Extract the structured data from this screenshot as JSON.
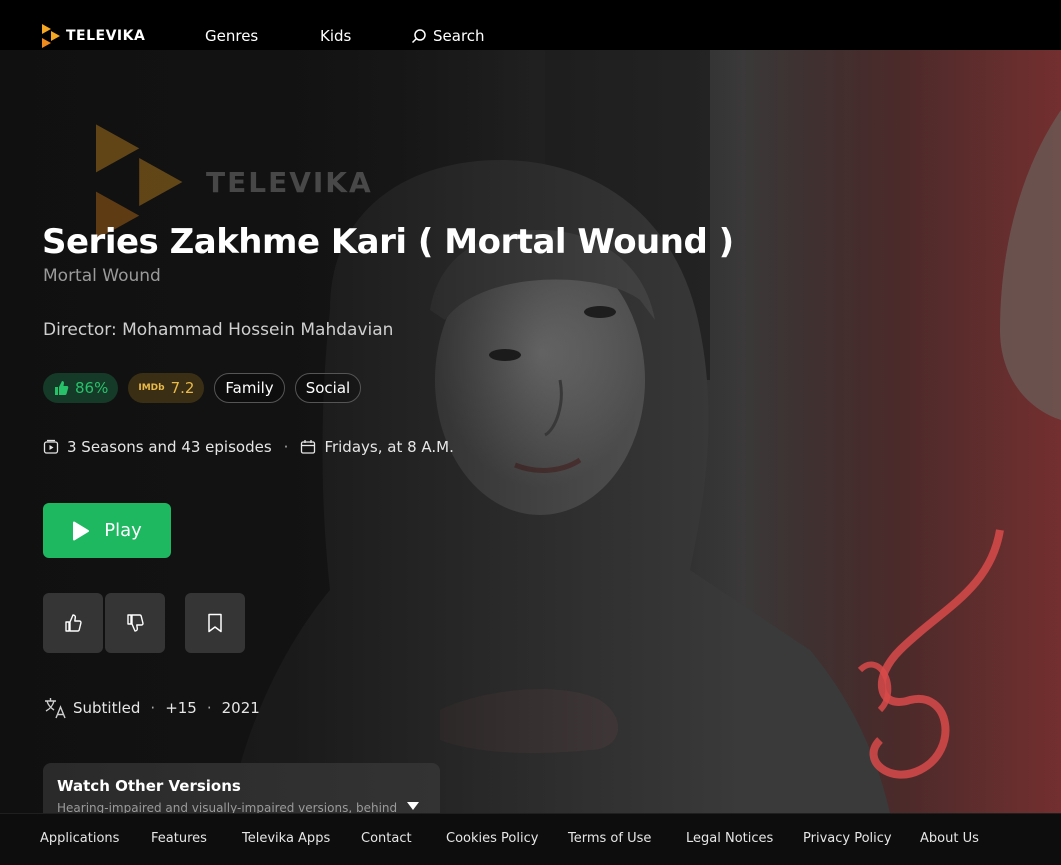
{
  "brand": {
    "name": "TELEVIKA",
    "accent": "#f5a623"
  },
  "nav": {
    "genres": "Genres",
    "kids": "Kids",
    "search": "Search"
  },
  "hero": {
    "watermark_title": "TELEVIKA",
    "title": "Series Zakhme Kari ( Mortal Wound )",
    "subtitle": "Mortal Wound",
    "director": "Director: Mohammad Hossein Mahdavian",
    "like_percent": "86%",
    "imdb_label": "IMDb",
    "imdb_score": "7.2",
    "genres": [
      "Family",
      "Social"
    ],
    "seasons": "3 Seasons and 43 episodes",
    "schedule": "Fridays, at 8 A.M.",
    "play_label": "Play",
    "subtitled": "Subtitled",
    "age_rating": "+15",
    "year": "2021",
    "versions_title": "Watch Other Versions",
    "versions_desc": "Hearing-impaired and visually-impaired versions, behind"
  },
  "footer": {
    "links": [
      "Applications",
      "Features",
      "Televika Apps",
      "Contact",
      "Cookies Policy",
      "Terms of Use",
      "Legal Notices",
      "Privacy Policy",
      "About Us"
    ]
  },
  "colors": {
    "play": "#1db860",
    "like": "#27c16a",
    "imdb": "#e9b949"
  }
}
